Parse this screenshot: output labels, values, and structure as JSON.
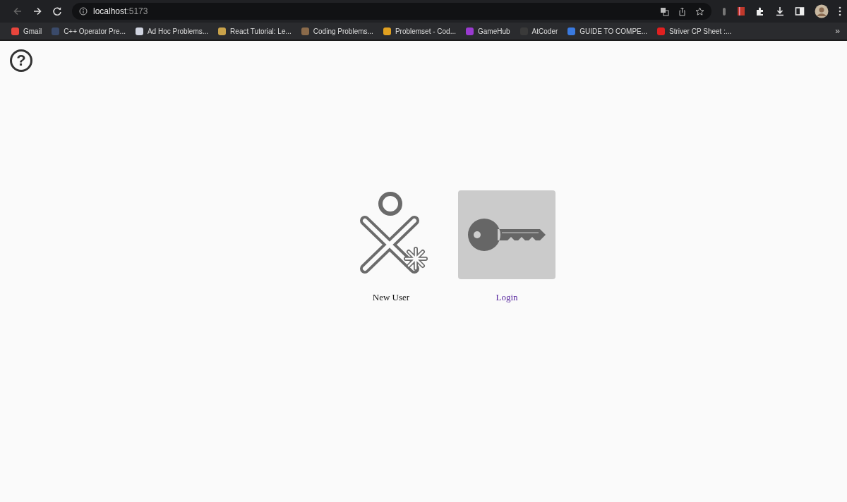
{
  "browser": {
    "address": {
      "host": "localhost",
      "port": ":5173"
    },
    "bookmarks": [
      {
        "label": "Gmail",
        "color": "#e8453c"
      },
      {
        "label": "C++ Operator Pre...",
        "color": "#3a4a6a"
      },
      {
        "label": "Ad Hoc Problems...",
        "color": "#d0d4e0"
      },
      {
        "label": "React Tutorial: Le...",
        "color": "#c9a24a"
      },
      {
        "label": "Coding Problems...",
        "color": "#8a6a4a"
      },
      {
        "label": "Problemset - Cod...",
        "color": "#e0a020"
      },
      {
        "label": "GameHub",
        "color": "#9a3ad0"
      },
      {
        "label": "AtCoder",
        "color": "#3a3a3a"
      },
      {
        "label": "GUIDE TO COMPE...",
        "color": "#3a7ae0"
      },
      {
        "label": "Striver CP Sheet :...",
        "color": "#e02020"
      }
    ],
    "more": "»"
  },
  "page": {
    "help": "?",
    "choices": [
      {
        "kind": "new-user",
        "label": "New User",
        "selected": false
      },
      {
        "kind": "login",
        "label": "Login",
        "selected": true
      }
    ]
  }
}
